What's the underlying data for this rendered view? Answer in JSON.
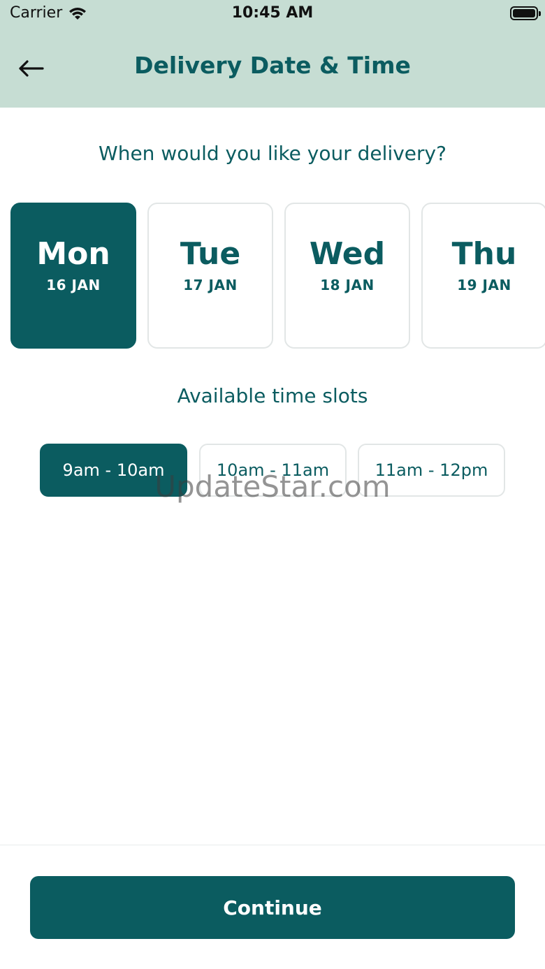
{
  "status_bar": {
    "carrier": "Carrier",
    "time": "10:45 AM",
    "wifi_icon": "wifi-icon",
    "battery_icon": "battery-icon"
  },
  "header": {
    "title": "Delivery Date & Time",
    "back_icon": "arrow-left-icon"
  },
  "question": "When would you like your delivery?",
  "days": [
    {
      "name": "Mon",
      "date": "16 JAN",
      "selected": true
    },
    {
      "name": "Tue",
      "date": "17 JAN",
      "selected": false
    },
    {
      "name": "Wed",
      "date": "18 JAN",
      "selected": false
    },
    {
      "name": "Thu",
      "date": "19 JAN",
      "selected": false
    }
  ],
  "slots_title": "Available time slots",
  "slots": [
    {
      "label": "9am - 10am",
      "selected": true
    },
    {
      "label": "10am - 11am",
      "selected": false
    },
    {
      "label": "11am - 12pm",
      "selected": false
    }
  ],
  "watermark": "UpdateStar.com",
  "continue_label": "Continue",
  "colors": {
    "accent": "#0b5c60",
    "header_bg": "#c6ddd3",
    "card_border": "#e2e6e6"
  }
}
